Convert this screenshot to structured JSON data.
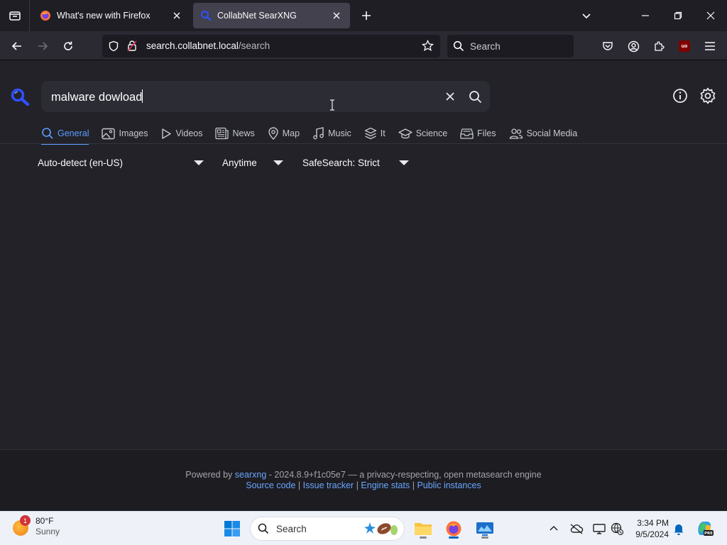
{
  "browser": {
    "tabs": [
      {
        "title": "What's new with Firefox",
        "active": false
      },
      {
        "title": "CollabNet SearXNG",
        "active": true
      }
    ],
    "url": {
      "host": "search.collabnet.local",
      "path": "/search"
    },
    "search_placeholder": "Search"
  },
  "search": {
    "query": "malware dowload"
  },
  "categories": [
    {
      "label": "General",
      "icon": "search-icon",
      "active": true
    },
    {
      "label": "Images",
      "icon": "image-icon",
      "active": false
    },
    {
      "label": "Videos",
      "icon": "play-icon",
      "active": false
    },
    {
      "label": "News",
      "icon": "newspaper-icon",
      "active": false
    },
    {
      "label": "Map",
      "icon": "map-pin-icon",
      "active": false
    },
    {
      "label": "Music",
      "icon": "music-note-icon",
      "active": false
    },
    {
      "label": "It",
      "icon": "layers-icon",
      "active": false
    },
    {
      "label": "Science",
      "icon": "graduation-cap-icon",
      "active": false
    },
    {
      "label": "Files",
      "icon": "file-tray-icon",
      "active": false
    },
    {
      "label": "Social Media",
      "icon": "people-icon",
      "active": false
    }
  ],
  "filters": {
    "language": "Auto-detect (en-US)",
    "time_range": "Anytime",
    "safesearch": "SafeSearch: Strict"
  },
  "footer": {
    "powered_by": "Powered by",
    "engine_link": "searxng",
    "version_text": "- 2024.8.9+f1c05e7 — a privacy-respecting, open metasearch engine",
    "links": [
      "Source code",
      "Issue tracker",
      "Engine stats",
      "Public instances"
    ],
    "separator": "|"
  },
  "taskbar": {
    "weather": {
      "temp": "80°F",
      "condition": "Sunny",
      "badge": "1"
    },
    "search_label": "Search",
    "clock": {
      "time": "3:34 PM",
      "date": "9/5/2024"
    }
  },
  "colors": {
    "accent": "#5c9dff",
    "page_bg": "#222228",
    "chrome_bg": "#2b2a33"
  }
}
